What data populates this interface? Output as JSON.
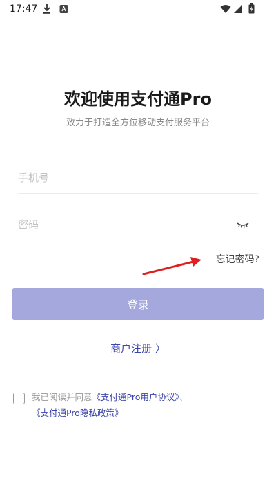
{
  "status_bar": {
    "time": "17:47",
    "left_icons": [
      "download-icon",
      "app-notification-icon"
    ],
    "right_icons": [
      "wifi-icon",
      "signal-icon",
      "battery-icon"
    ]
  },
  "header": {
    "title": "欢迎使用支付通Pro",
    "subtitle": "致力于打造全方位移动支付服务平台"
  },
  "form": {
    "phone_placeholder": "手机号",
    "password_placeholder": "密码",
    "forgot_password": "忘记密码?",
    "login_button": "登录",
    "register_link": "商户注册 〉"
  },
  "agreement": {
    "prefix": "我已阅读并同意",
    "user_agreement": "《支付通Pro用户协议》",
    "separator": "、",
    "privacy_policy": "《支付通Pro隐私政策》"
  },
  "colors": {
    "primary": "#3b44a8",
    "button_disabled": "#a5a8dc",
    "annotation_arrow": "#e02020"
  }
}
